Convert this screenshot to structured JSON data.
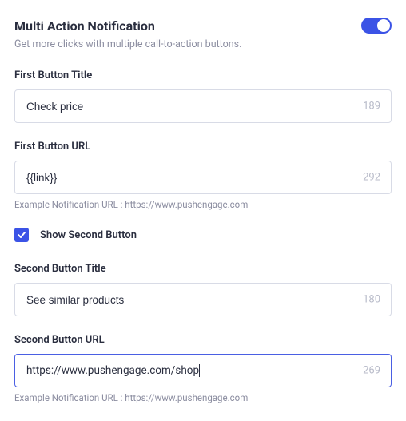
{
  "header": {
    "title": "Multi Action Notification",
    "subtitle": "Get more clicks with multiple call-to-action buttons.",
    "toggle_on": true
  },
  "button1": {
    "title_label": "First Button Title",
    "title_value": "Check price",
    "title_remaining": "189",
    "url_label": "First Button URL",
    "url_value": "{{link}}",
    "url_remaining": "292",
    "url_hint": "Example Notification URL : https://www.pushengage.com"
  },
  "second": {
    "checkbox_checked": true,
    "checkbox_label": "Show Second Button"
  },
  "button2": {
    "title_label": "Second Button Title",
    "title_value": "See similar products",
    "title_remaining": "180",
    "url_label": "Second Button URL",
    "url_value": "https://www.pushengage.com/shop",
    "url_remaining": "269",
    "url_hint": "Example Notification URL : https://www.pushengage.com"
  }
}
